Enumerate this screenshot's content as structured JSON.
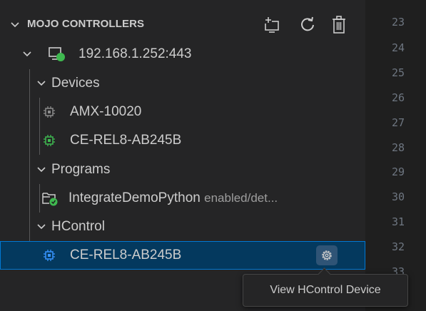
{
  "panel": {
    "title": "MOJO CONTROLLERS",
    "toolbar": {
      "add": "add-controller-icon",
      "refresh": "refresh-icon",
      "delete": "trash-icon"
    }
  },
  "tree": {
    "controller": {
      "label": "192.168.1.252:443",
      "status_color": "#3fb950"
    },
    "devices": {
      "label": "Devices",
      "items": [
        {
          "label": "AMX-10020",
          "icon_color": "#8b8b8b"
        },
        {
          "label": "CE-REL8-AB245B",
          "icon_color": "#3fb950"
        }
      ]
    },
    "programs": {
      "label": "Programs",
      "items": [
        {
          "label": "IntegrateDemoPython",
          "description": "enabled/det..."
        }
      ]
    },
    "hcontrol": {
      "label": "HControl",
      "items": [
        {
          "label": "CE-REL8-AB245B",
          "icon_color": "#3794ff"
        }
      ]
    }
  },
  "tooltip": {
    "text": "View HControl Device"
  },
  "editor": {
    "line_numbers": [
      "23",
      "24",
      "25",
      "26",
      "27",
      "28",
      "29",
      "30",
      "31",
      "32",
      "33"
    ]
  }
}
